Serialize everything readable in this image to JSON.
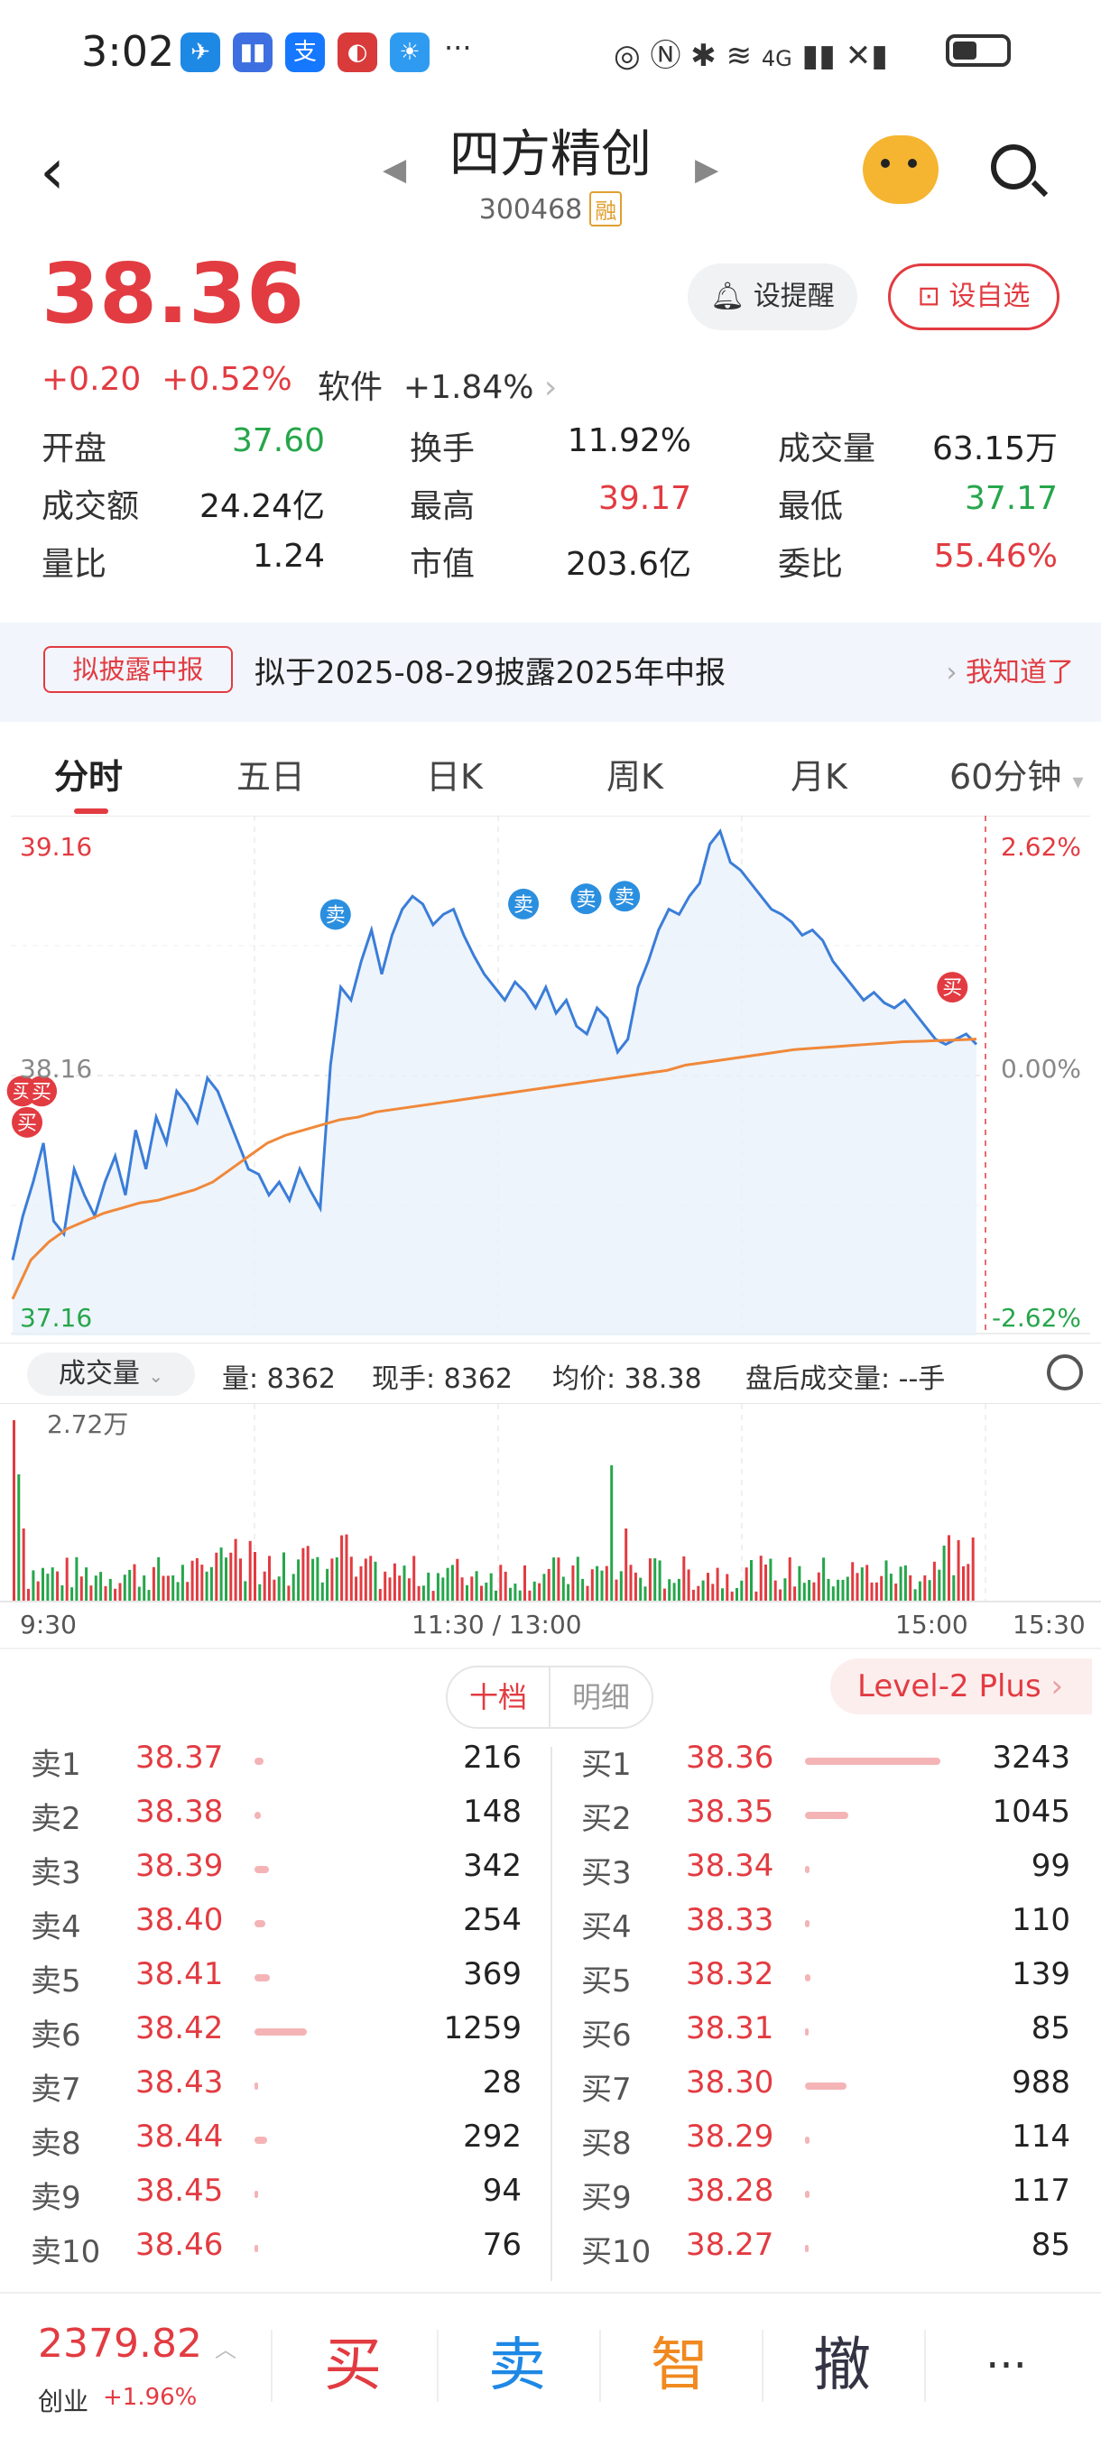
{
  "status_bar": {
    "time": "3:02",
    "apps": [
      "✈",
      "▮▮",
      "支",
      "◐",
      "☀"
    ],
    "more": "···",
    "network": "4G"
  },
  "header": {
    "title": "四方精创",
    "code": "300468",
    "margin_tag": "融"
  },
  "quote": {
    "price": "38.36",
    "change": "+0.20",
    "change_pct": "+0.52%",
    "sector": "软件",
    "sector_pct": "+1.84%",
    "alert_button": "设提醒",
    "fav_button": "设自选",
    "stats": [
      [
        {
          "label": "开盘",
          "value": "37.60",
          "color": "green"
        },
        {
          "label": "换手",
          "value": "11.92%",
          "color": "dark"
        },
        {
          "label": "成交量",
          "value": "63.15万",
          "color": "dark"
        }
      ],
      [
        {
          "label": "成交额",
          "value": "24.24亿",
          "color": "dark"
        },
        {
          "label": "最高",
          "value": "39.17",
          "color": "red"
        },
        {
          "label": "最低",
          "value": "37.17",
          "color": "green"
        }
      ],
      [
        {
          "label": "量比",
          "value": "1.24",
          "color": "dark"
        },
        {
          "label": "市值",
          "value": "203.6亿",
          "color": "dark"
        },
        {
          "label": "委比",
          "value": "55.46%",
          "color": "red"
        }
      ]
    ]
  },
  "notice": {
    "tag": "拟披露中报",
    "text": "拟于2025-08-29披露2025年中报",
    "link": "我知道了"
  },
  "tabs": [
    "分时",
    "五日",
    "日K",
    "周K",
    "月K",
    "60分钟"
  ],
  "chart_data": {
    "type": "line",
    "title": "",
    "y_left_ticks": [
      "39.16",
      "38.16",
      "37.16"
    ],
    "y_right_ticks": [
      "2.62%",
      "0.00%",
      "-2.62%"
    ],
    "ylim": [
      37.16,
      39.16
    ],
    "x_ticks": [
      "9:30",
      "11:30 / 13:00",
      "15:00",
      "15:30"
    ],
    "series": [
      {
        "values": [
          37.45,
          37.62,
          37.75,
          37.9,
          37.6,
          37.55,
          37.8,
          37.7,
          37.62,
          37.75,
          37.85,
          37.7,
          37.95,
          37.8,
          38.0,
          37.9,
          38.1,
          38.05,
          37.98,
          38.15,
          38.1,
          38.0,
          37.9,
          37.8,
          37.78,
          37.7,
          37.75,
          37.68,
          37.8,
          37.72,
          37.65,
          38.2,
          38.5,
          38.45,
          38.6,
          38.72,
          38.55,
          38.7,
          38.8,
          38.85,
          38.82,
          38.74,
          38.78,
          38.8,
          38.7,
          38.62,
          38.55,
          38.5,
          38.45,
          38.52,
          38.48,
          38.42,
          38.5,
          38.4,
          38.45,
          38.35,
          38.32,
          38.42,
          38.38,
          38.25,
          38.3,
          38.5,
          38.6,
          38.72,
          38.8,
          38.78,
          38.85,
          38.9,
          39.05,
          39.1,
          38.98,
          38.95,
          38.9,
          38.85,
          38.8,
          38.78,
          38.75,
          38.7,
          38.72,
          38.68,
          38.6,
          38.55,
          38.5,
          38.45,
          38.48,
          38.44,
          38.42,
          38.45,
          38.4,
          38.35,
          38.3,
          38.28,
          38.3,
          38.32,
          38.28
        ]
      },
      {
        "values": [
          37.3,
          37.45,
          37.52,
          37.57,
          37.6,
          37.63,
          37.65,
          37.67,
          37.68,
          37.7,
          37.72,
          37.75,
          37.8,
          37.85,
          37.9,
          37.93,
          37.95,
          37.97,
          37.99,
          38.0,
          38.02,
          38.03,
          38.04,
          38.05,
          38.06,
          38.07,
          38.08,
          38.09,
          38.1,
          38.11,
          38.12,
          38.13,
          38.14,
          38.15,
          38.16,
          38.17,
          38.18,
          38.2,
          38.21,
          38.22,
          38.23,
          38.24,
          38.25,
          38.26,
          38.265,
          38.27,
          38.275,
          38.28,
          38.285,
          38.29,
          38.292,
          38.295,
          38.297,
          38.3
        ]
      }
    ],
    "trade_markers": [
      {
        "label": "买",
        "x": 0.01,
        "y": 38.1
      },
      {
        "label": "买",
        "x": 0.03,
        "y": 38.1
      },
      {
        "label": "买",
        "x": 0.015,
        "y": 37.98
      },
      {
        "label": "卖",
        "x": 0.335,
        "y": 38.78
      },
      {
        "label": "卖",
        "x": 0.53,
        "y": 38.82
      },
      {
        "label": "卖",
        "x": 0.595,
        "y": 38.84
      },
      {
        "label": "卖",
        "x": 0.635,
        "y": 38.85
      },
      {
        "label": "买",
        "x": 0.975,
        "y": 38.5
      }
    ],
    "volume": {
      "label": "成交量",
      "max_label": "2.72万",
      "volume": "量: 8362",
      "last": "现手: 8362",
      "avg": "均价: 38.38",
      "after_hours": "盘后成交量: --手"
    }
  },
  "depth": {
    "toggle": [
      "十档",
      "明细"
    ],
    "level2": "Level-2 Plus",
    "asks": [
      {
        "label": "卖1",
        "price": "38.37",
        "vol": "216"
      },
      {
        "label": "卖2",
        "price": "38.38",
        "vol": "148"
      },
      {
        "label": "卖3",
        "price": "38.39",
        "vol": "342"
      },
      {
        "label": "卖4",
        "price": "38.40",
        "vol": "254"
      },
      {
        "label": "卖5",
        "price": "38.41",
        "vol": "369"
      },
      {
        "label": "卖6",
        "price": "38.42",
        "vol": "1259"
      },
      {
        "label": "卖7",
        "price": "38.43",
        "vol": "28"
      },
      {
        "label": "卖8",
        "price": "38.44",
        "vol": "292"
      },
      {
        "label": "卖9",
        "price": "38.45",
        "vol": "94"
      },
      {
        "label": "卖10",
        "price": "38.46",
        "vol": "76"
      }
    ],
    "bids": [
      {
        "label": "买1",
        "price": "38.36",
        "vol": "3243"
      },
      {
        "label": "买2",
        "price": "38.35",
        "vol": "1045"
      },
      {
        "label": "买3",
        "price": "38.34",
        "vol": "99"
      },
      {
        "label": "买4",
        "price": "38.33",
        "vol": "110"
      },
      {
        "label": "买5",
        "price": "38.32",
        "vol": "139"
      },
      {
        "label": "买6",
        "price": "38.31",
        "vol": "85"
      },
      {
        "label": "买7",
        "price": "38.30",
        "vol": "988"
      },
      {
        "label": "买8",
        "price": "38.29",
        "vol": "114"
      },
      {
        "label": "买9",
        "price": "38.28",
        "vol": "117"
      },
      {
        "label": "买10",
        "price": "38.27",
        "vol": "85"
      }
    ]
  },
  "bottom_bar": {
    "index_value": "2379.82",
    "index_name": "创业",
    "index_change": "+1.96%",
    "buy": "买",
    "sell": "卖",
    "smart": "智",
    "cancel": "撤",
    "more": "···"
  }
}
